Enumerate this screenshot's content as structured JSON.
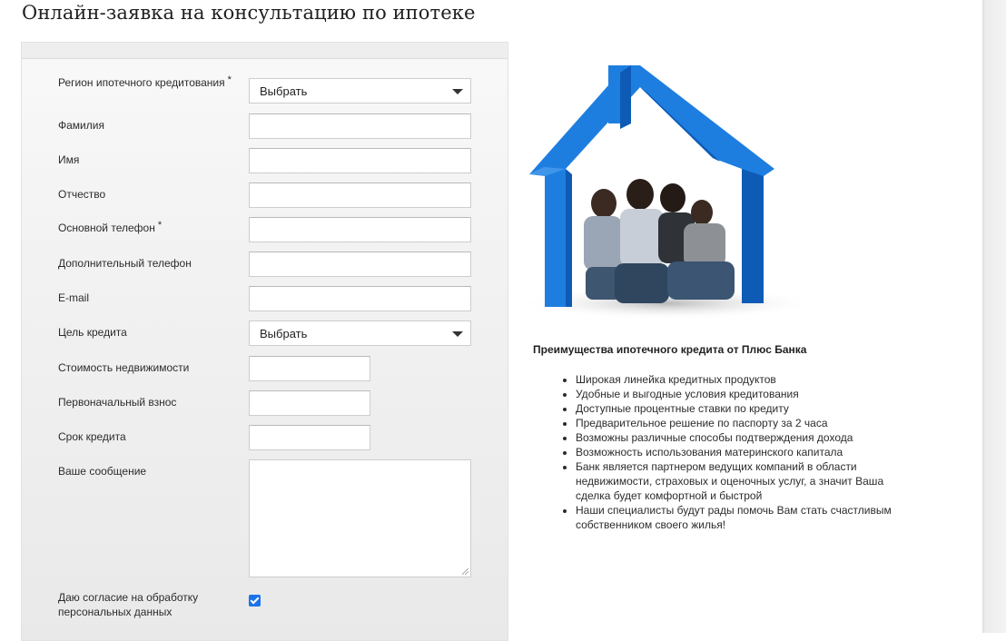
{
  "page": {
    "title": "Онлайн-заявка на консультацию по ипотеке"
  },
  "form": {
    "region_label": "Регион ипотечного кредитования",
    "region_value": "Выбрать",
    "required_mark": "*",
    "last_name_label": "Фамилия",
    "first_name_label": "Имя",
    "middle_name_label": "Отчество",
    "main_phone_label": "Основной телефон",
    "extra_phone_label": "Дополнительный телефон",
    "email_label": "E-mail",
    "purpose_label": "Цель кредита",
    "purpose_value": "Выбрать",
    "property_cost_label": "Стоимость недвижимости",
    "down_payment_label": "Первоначальный взнос",
    "term_label": "Срок кредита",
    "message_label": "Ваше сообщение",
    "consent_label_line1": "Даю согласие на обработку",
    "consent_label_line2": "персональных данных",
    "consent_checked": true
  },
  "benefits": {
    "title": "Преимущества ипотечного кредита от Плюс Банка",
    "items": [
      "Широкая линейка кредитных продуктов",
      "Удобные и выгодные условия кредитования",
      "Доступные процентные ставки по кредиту",
      "Предварительное решение по паспорту за 2 часа",
      "Возможны различные способы подтверждения дохода",
      "Возможность использования материнского капитала",
      "Банк является партнером ведущих компаний в области недвижимости, страховых и оценочных услуг, а значит Ваша сделка будет комфортной и быстрой",
      "Наши специалисты будут рады помочь Вам стать счастливым собственником своего жилья!"
    ]
  },
  "colors": {
    "house_blue": "#1e7ee0",
    "house_dark": "#0e5bb5",
    "checkbox_blue": "#1a73e8"
  },
  "icons": [
    "chevron-down-icon",
    "resize-grip-icon",
    "checkmark-icon"
  ]
}
